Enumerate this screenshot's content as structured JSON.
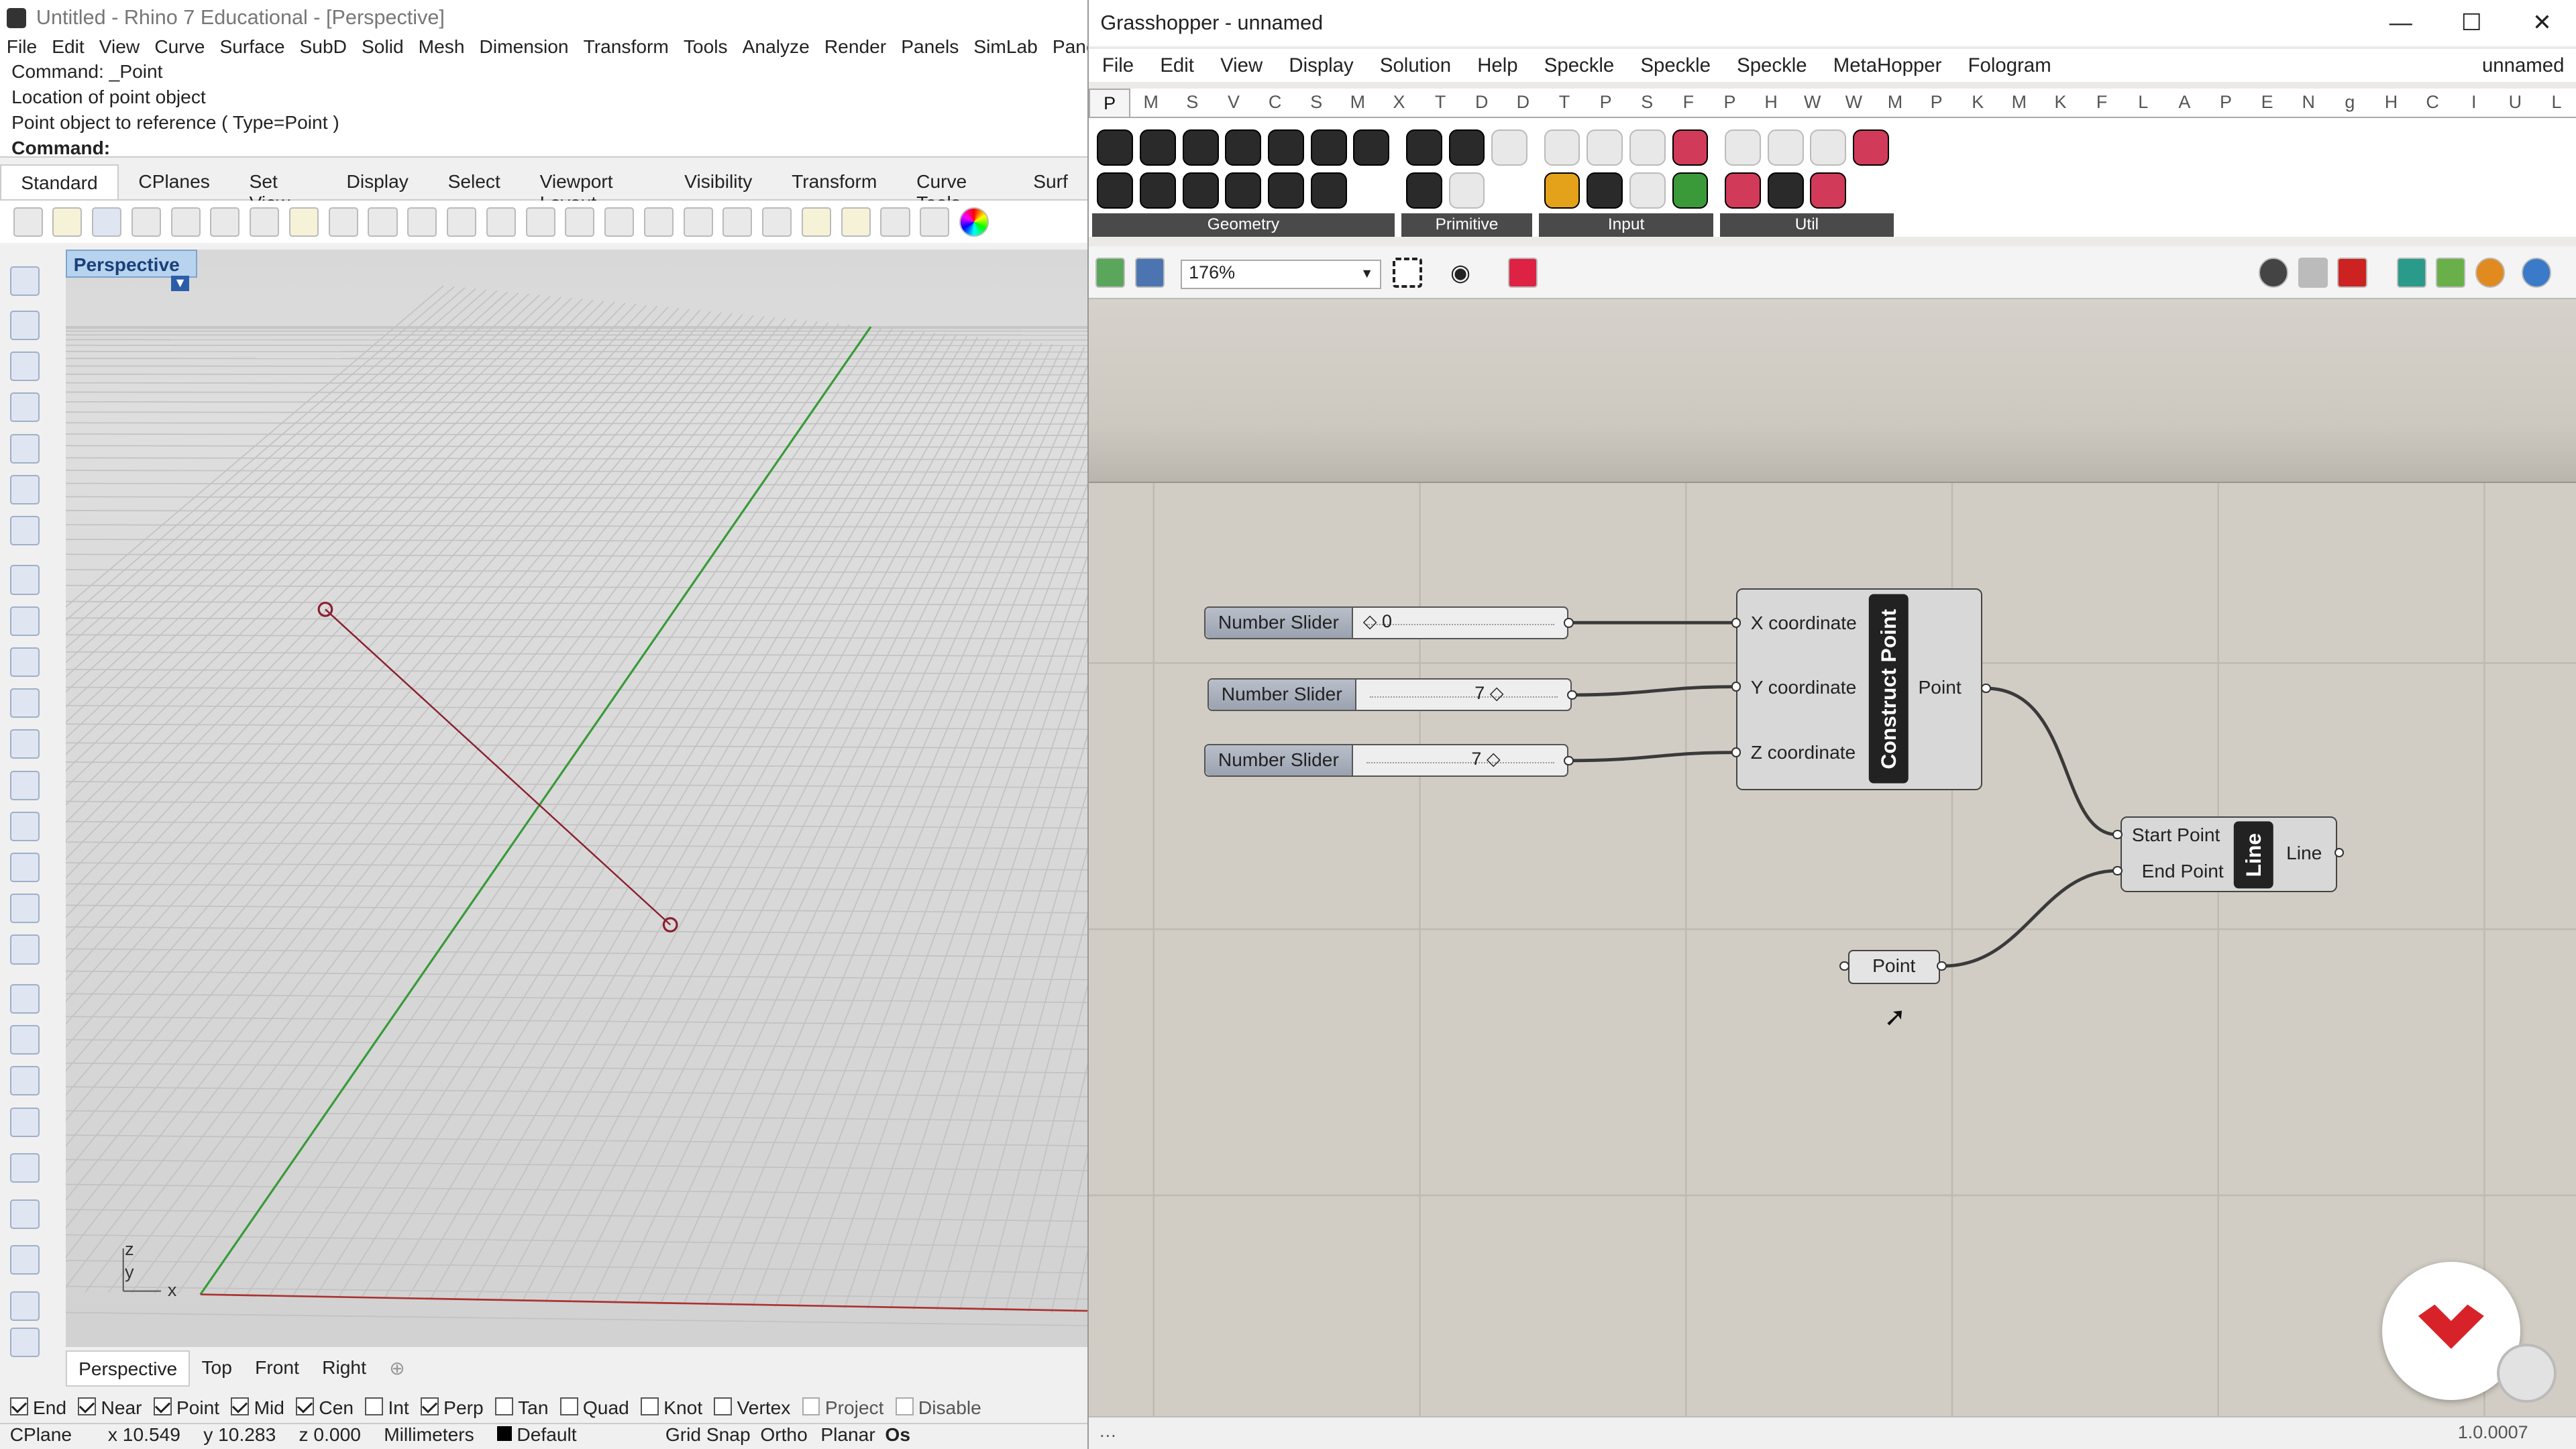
{
  "rhino": {
    "title": "Untitled - Rhino 7 Educational - [Perspective]",
    "menu": [
      "File",
      "Edit",
      "View",
      "Curve",
      "Surface",
      "SubD",
      "Solid",
      "Mesh",
      "Dimension",
      "Transform",
      "Tools",
      "Analyze",
      "Render",
      "Panels",
      "SimLab",
      "Paneling Tools"
    ],
    "command_history": [
      "Command: _Point",
      "Location of point object",
      "Point object to reference ( Type=Point )"
    ],
    "command_prompt": "Command:",
    "toolbar_tabs": [
      "Standard",
      "CPlanes",
      "Set View",
      "Display",
      "Select",
      "Viewport Layout",
      "Visibility",
      "Transform",
      "Curve Tools",
      "Surf"
    ],
    "active_toolbar_tab": "Standard",
    "viewport_label": "Perspective",
    "axis_labels": {
      "z": "z",
      "y": "y",
      "x": "x"
    },
    "viewport_tabs": [
      "Perspective",
      "Top",
      "Front",
      "Right"
    ],
    "osnaps": [
      {
        "label": "End",
        "checked": true
      },
      {
        "label": "Near",
        "checked": true
      },
      {
        "label": "Point",
        "checked": true
      },
      {
        "label": "Mid",
        "checked": true
      },
      {
        "label": "Cen",
        "checked": true
      },
      {
        "label": "Int",
        "checked": false
      },
      {
        "label": "Perp",
        "checked": true
      },
      {
        "label": "Tan",
        "checked": false
      },
      {
        "label": "Quad",
        "checked": false
      },
      {
        "label": "Knot",
        "checked": false
      },
      {
        "label": "Vertex",
        "checked": false
      },
      {
        "label": "Project",
        "checked": false
      },
      {
        "label": "Disable",
        "checked": false
      }
    ],
    "status": {
      "cplane": "CPlane",
      "x": "x 10.549",
      "y": "y 10.283",
      "z": "z 0.000",
      "units": "Millimeters",
      "layer": "Default",
      "grid_snap": "Grid Snap",
      "ortho": "Ortho",
      "planar": "Planar",
      "osnap": "Os"
    }
  },
  "gh": {
    "title": "Grasshopper - unnamed",
    "window_controls": [
      "—",
      "☐",
      "✕"
    ],
    "menu": [
      "File",
      "Edit",
      "View",
      "Display",
      "Solution",
      "Help",
      "Speckle",
      "Speckle",
      "Speckle",
      "MetaHopper",
      "Fologram"
    ],
    "doc_name": "unnamed",
    "category_tabs": [
      "P",
      "M",
      "S",
      "V",
      "C",
      "S",
      "M",
      "X",
      "T",
      "D",
      "D",
      "T",
      "P",
      "S",
      "F",
      "P",
      "H",
      "W",
      "W",
      "M",
      "P",
      "K",
      "M",
      "K",
      "F",
      "L",
      "A",
      "P",
      "E",
      "N",
      "g",
      "H",
      "C",
      "I",
      "U",
      "L"
    ],
    "ribbon_groups": [
      "Geometry",
      "Primitive",
      "Input",
      "Util"
    ],
    "zoom": "176%",
    "sliders": [
      {
        "name": "Number Slider",
        "value": "0"
      },
      {
        "name": "Number Slider",
        "value": "7"
      },
      {
        "name": "Number Slider",
        "value": "7"
      }
    ],
    "construct_point": {
      "title": "Construct Point",
      "inputs": [
        "X coordinate",
        "Y coordinate",
        "Z coordinate"
      ],
      "output": "Point"
    },
    "line": {
      "title": "Line",
      "inputs": [
        "Start Point",
        "End Point"
      ],
      "output": "Line"
    },
    "point_param": "Point",
    "version": "1.0.0007"
  }
}
